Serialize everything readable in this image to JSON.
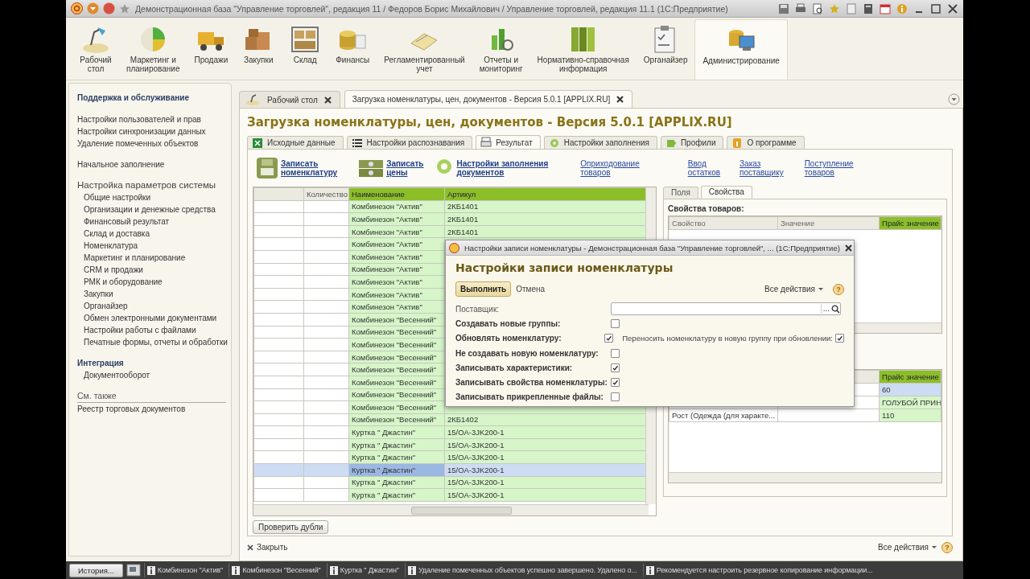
{
  "window": {
    "title": "Демонстрационная база \"Управление торговлей\", редакция 11 / Федоров Борис Михайлович / Управление торговлей, редакция 11.1  (1С:Предприятие)"
  },
  "sections": [
    {
      "label": "Рабочий\nстол",
      "selected": false
    },
    {
      "label": "Маркетинг и\nпланирование",
      "selected": false
    },
    {
      "label": "Продажи",
      "selected": false
    },
    {
      "label": "Закупки",
      "selected": false
    },
    {
      "label": "Склад",
      "selected": false
    },
    {
      "label": "Финансы",
      "selected": false
    },
    {
      "label": "Регламентированный\nучет",
      "selected": false
    },
    {
      "label": "Отчеты и\nмониторинг",
      "selected": false
    },
    {
      "label": "Нормативно-справочная\nинформация",
      "selected": false
    },
    {
      "label": "Органайзер",
      "selected": false
    },
    {
      "label": "Администрирование",
      "selected": true
    }
  ],
  "sidebar": {
    "groups": [
      {
        "kind": "bold",
        "indented": false,
        "title": "Поддержка и обслуживание",
        "items": [
          "Настройки пользователей и прав",
          "Настройки синхронизации данных",
          "Удаление помеченных объектов"
        ]
      },
      {
        "kind": "plain",
        "indented": false,
        "items": [
          "Начальное заполнение"
        ]
      },
      {
        "kind": "large",
        "indented": true,
        "title": "Настройка параметров системы",
        "items": [
          "Общие настройки",
          "Организации и денежные средства",
          "Финансовый результат",
          "Склад и доставка",
          "Номенклатура",
          "Маркетинг и планирование",
          "CRM и продажи",
          "РМК и оборудование",
          "Закупки",
          "Органайзер",
          "Обмен электронными документами",
          "Настройки работы с файлами",
          "Печатные формы, отчеты и обработки"
        ]
      },
      {
        "kind": "bold",
        "indented": true,
        "title": "Интеграция",
        "items": [
          "Документооборот"
        ]
      },
      {
        "kind": "see-also",
        "indented": false,
        "title": "См. также",
        "items": [
          "Реестр торговых документов"
        ]
      }
    ]
  },
  "open_tabs": [
    {
      "label": "Рабочий стол",
      "selected": false
    },
    {
      "label": "Загрузка номенклатуры, цен, документов - Версия 5.0.1 [APPLIX.RU]",
      "selected": true
    }
  ],
  "form": {
    "title": "Загрузка номенклатуры, цен, документов - Версия 5.0.1 [APPLIX.RU]",
    "tabs": [
      {
        "label": "Исходные данные",
        "selected": false
      },
      {
        "label": "Настройки распознавания",
        "selected": false
      },
      {
        "label": "Результат",
        "selected": true
      },
      {
        "label": "Настройки заполнения",
        "selected": false
      },
      {
        "label": "Профили",
        "selected": false
      },
      {
        "label": "О программе",
        "selected": false
      }
    ],
    "commands": [
      {
        "kind": "icon-command",
        "label": "Записать\nноменклатуру"
      },
      {
        "kind": "icon-command",
        "label": "Записать\nцены"
      },
      {
        "kind": "icon-command",
        "label": "Настройки заполнения\nдокументов"
      },
      {
        "kind": "link",
        "label": "Оприходование\nтоваров"
      },
      {
        "kind": "link",
        "label": "Ввод\nостатков"
      },
      {
        "kind": "link",
        "label": "Заказ\nпоставщику"
      },
      {
        "kind": "link",
        "label": "Поступление\nтоваров"
      }
    ],
    "table": {
      "columns": [
        "Количество",
        "Наименование",
        "Артикул"
      ],
      "rows": [
        {
          "name": "Комбинезон \"Актив\"",
          "article": "2КБ1401",
          "selected": false
        },
        {
          "name": "Комбинезон \"Актив\"",
          "article": "2КБ1401",
          "selected": false
        },
        {
          "name": "Комбинезон \"Актив\"",
          "article": "2КБ1401",
          "selected": false
        },
        {
          "name": "Комбинезон \"Актив\"",
          "selected": false
        },
        {
          "name": "Комбинезон \"Актив\"",
          "selected": false
        },
        {
          "name": "Комбинезон \"Актив\"",
          "selected": false
        },
        {
          "name": "Комбинезон \"Актив\"",
          "selected": false
        },
        {
          "name": "Комбинезон \"Актив\"",
          "selected": false
        },
        {
          "name": "Комбинезон \"Актив\"",
          "selected": false
        },
        {
          "name": "Комбинезон \"Весенний\"",
          "selected": false
        },
        {
          "name": "Комбинезон \"Весенний\"",
          "selected": false
        },
        {
          "name": "Комбинезон \"Весенний\"",
          "selected": false
        },
        {
          "name": "Комбинезон \"Весенний\"",
          "selected": false
        },
        {
          "name": "Комбинезон \"Весенний\"",
          "selected": false
        },
        {
          "name": "Комбинезон \"Весенний\"",
          "selected": false
        },
        {
          "name": "Комбинезон \"Весенний\"",
          "selected": false
        },
        {
          "name": "Комбинезон \"Весенний\"",
          "selected": false
        },
        {
          "name": "Комбинезон \"Весенний\"",
          "article": "2КБ1402",
          "selected": false
        },
        {
          "name": "Куртка \" Джастин\"",
          "article": "15/ОА-3JK200-1",
          "selected": false
        },
        {
          "name": "Куртка \" Джастин\"",
          "article": "15/ОА-3JK200-1",
          "selected": false
        },
        {
          "name": "Куртка \" Джастин\"",
          "article": "15/ОА-3JK200-1",
          "selected": false
        },
        {
          "name": "Куртка \" Джастин\"",
          "article": "15/ОА-3JK200-1",
          "selected": true
        },
        {
          "name": "Куртка \" Джастин\"",
          "article": "15/ОА-3JK200-1",
          "selected": false
        },
        {
          "name": "Куртка \" Джастин\"",
          "article": "15/ОА-3JK200-1",
          "selected": false
        }
      ]
    },
    "check_duplicates_button": "Проверить дубли",
    "properties": {
      "tabs": [
        {
          "label": "Поля",
          "selected": false
        },
        {
          "label": "Свойства",
          "selected": true
        }
      ],
      "caption": "Свойства товаров:",
      "columns": [
        "Свойство",
        "Значение",
        "Прайс значение"
      ],
      "lower_table": {
        "price_column": "Прайс значение",
        "rows": [
          {
            "price": "60",
            "selected": true
          },
          {
            "price": "ГОЛУБОЙ ПРИН",
            "selected": false
          },
          {
            "property": "Рост (Одежда (для характе...",
            "price": "110",
            "selected": false
          }
        ]
      }
    },
    "close_button": "Закрыть",
    "all_actions": "Все действия",
    "help": "?"
  },
  "dialog": {
    "title": "Настройки записи номенклатуры - Демонстрационная база \"Управление торговлей\", ... (1С:Предприятие)",
    "heading": "Настройки записи номенклатуры",
    "run_button": "Выполнить",
    "cancel_button": "Отмена",
    "all_actions": "Все действия",
    "help": "?",
    "supplier": {
      "label": "Поставщик:",
      "choose_button": "..."
    },
    "options": [
      {
        "label": "Создавать новые группы:",
        "checked": false
      },
      {
        "label": "Обновлять номенклатуру:",
        "checked": true,
        "extra": {
          "label": "Переносить номенклатуру в новую группу при обновлении:",
          "checked": true
        }
      },
      {
        "label": "Не создавать новую номенклатуру:",
        "checked": false
      },
      {
        "label": "Записывать характеристики:",
        "checked": true
      },
      {
        "label": "Записывать свойства номенклатуры:",
        "checked": true
      },
      {
        "label": "Записывать прикрепленные файлы:",
        "checked": false
      }
    ]
  },
  "status_bar": {
    "history_button": "История...",
    "messages": [
      "Комбинезон \"Актив\"",
      "Комбинезон \"Весенний\"",
      "Куртка \" Джастин\"",
      "Удаление помеченных объектов успешно завершено. Удалено о...",
      "Рекомендуется настроить резервное копирование информации..."
    ]
  }
}
